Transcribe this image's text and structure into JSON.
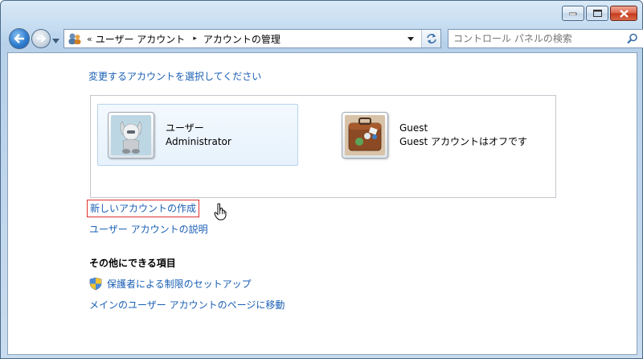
{
  "window": {
    "caption_buttons": [
      "minimize",
      "maximize",
      "close"
    ]
  },
  "address_bar": {
    "chevron": "«",
    "breadcrumbs": [
      "ユーザー アカウント",
      "アカウントの管理"
    ],
    "separator": "▸"
  },
  "search": {
    "placeholder": "コントロール パネルの検索"
  },
  "content": {
    "heading": "変更するアカウントを選択してください",
    "accounts": [
      {
        "name": "ユーザー",
        "detail": "Administrator",
        "selected": true
      },
      {
        "name": "Guest",
        "detail": "Guest アカウントはオフです",
        "selected": false
      }
    ],
    "create_account_link": "新しいアカウントの作成",
    "explain_link": "ユーザー アカウントの説明",
    "other_title": "その他にできる項目",
    "parental_link": "保護者による制限のセットアップ",
    "main_page_link": "メインのユーザー アカウントのページに移動"
  },
  "colors": {
    "link": "#1a5fb4",
    "highlight_border": "#e03030",
    "selected_bg": "#e7f2fc"
  }
}
